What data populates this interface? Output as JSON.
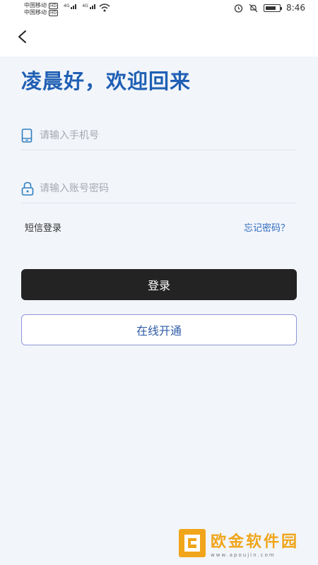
{
  "status_bar": {
    "carrier1": "中国移动",
    "carrier2": "中国移动",
    "hd": "HD",
    "network1": "4G",
    "network2": "4G",
    "time": "8:46",
    "icons": [
      "alarm-icon",
      "mute-icon",
      "battery-icon",
      "wifi-icon",
      "signal-icon"
    ]
  },
  "nav": {
    "back_icon": "chevron-left-icon"
  },
  "greeting": "凌晨好，欢迎回来",
  "form": {
    "phone_placeholder": "请输入手机号",
    "phone_value": "",
    "password_placeholder": "请输入账号密码",
    "password_value": "",
    "phone_icon": "phone-icon",
    "lock_icon": "lock-icon"
  },
  "links": {
    "sms_login": "短信登录",
    "forgot_password": "忘记密码？"
  },
  "buttons": {
    "login": "登录",
    "open_online": "在线开通"
  },
  "watermark": {
    "title": "欧金软件园",
    "url": "www.apoujin.com"
  },
  "colors": {
    "accent": "#1f5fb4",
    "login_button": "#232323",
    "link": "#2f6bbf",
    "background": "#f2f5fa",
    "watermark": "#f0a51a"
  }
}
